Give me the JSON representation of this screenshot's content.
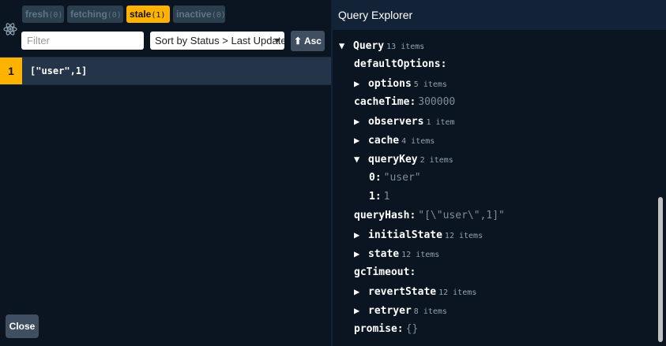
{
  "filters": [
    {
      "label": "fresh",
      "count": "(0)",
      "active": false
    },
    {
      "label": "fetching",
      "count": "(0)",
      "active": false
    },
    {
      "label": "stale",
      "count": "(1)",
      "active": true
    },
    {
      "label": "inactive",
      "count": "(0)",
      "active": false
    }
  ],
  "toolbar": {
    "filter_placeholder": "Filter",
    "sort_value": "Sort by Status > Last Updated",
    "order_button": "⬆ Asc"
  },
  "queries": [
    {
      "observers": "1",
      "key": "[\"user\",1]",
      "status_color": "#ffb200"
    }
  ],
  "close_button": "Close",
  "explorer": {
    "title": "Query Explorer",
    "tree": [
      {
        "depth": 0,
        "arrow": "▼",
        "label": "Query",
        "meta": "13 items"
      },
      {
        "depth": 1,
        "arrow": "",
        "label": "defaultOptions:"
      },
      {
        "depth": 1,
        "arrow": "▶",
        "label": "options",
        "meta": "5 items"
      },
      {
        "depth": 1,
        "arrow": "",
        "label": "cacheTime:",
        "value": "300000"
      },
      {
        "depth": 1,
        "arrow": "▶",
        "label": "observers",
        "meta": "1 item"
      },
      {
        "depth": 1,
        "arrow": "▶",
        "label": "cache",
        "meta": "4 items"
      },
      {
        "depth": 1,
        "arrow": "▼",
        "label": "queryKey",
        "meta": "2 items"
      },
      {
        "depth": 2,
        "arrow": "",
        "label": "0:",
        "value": "\"user\""
      },
      {
        "depth": 2,
        "arrow": "",
        "label": "1:",
        "value": "1"
      },
      {
        "depth": 1,
        "arrow": "",
        "label": "queryHash:",
        "value": "\"[\\\"user\\\",1]\""
      },
      {
        "depth": 1,
        "arrow": "▶",
        "label": "initialState",
        "meta": "12 items"
      },
      {
        "depth": 1,
        "arrow": "▶",
        "label": "state",
        "meta": "12 items"
      },
      {
        "depth": 1,
        "arrow": "",
        "label": "gcTimeout:"
      },
      {
        "depth": 1,
        "arrow": "▶",
        "label": "revertState",
        "meta": "12 items"
      },
      {
        "depth": 1,
        "arrow": "▶",
        "label": "retryer",
        "meta": "8 items"
      },
      {
        "depth": 1,
        "arrow": "",
        "label": "promise:",
        "value": "{}"
      }
    ]
  }
}
